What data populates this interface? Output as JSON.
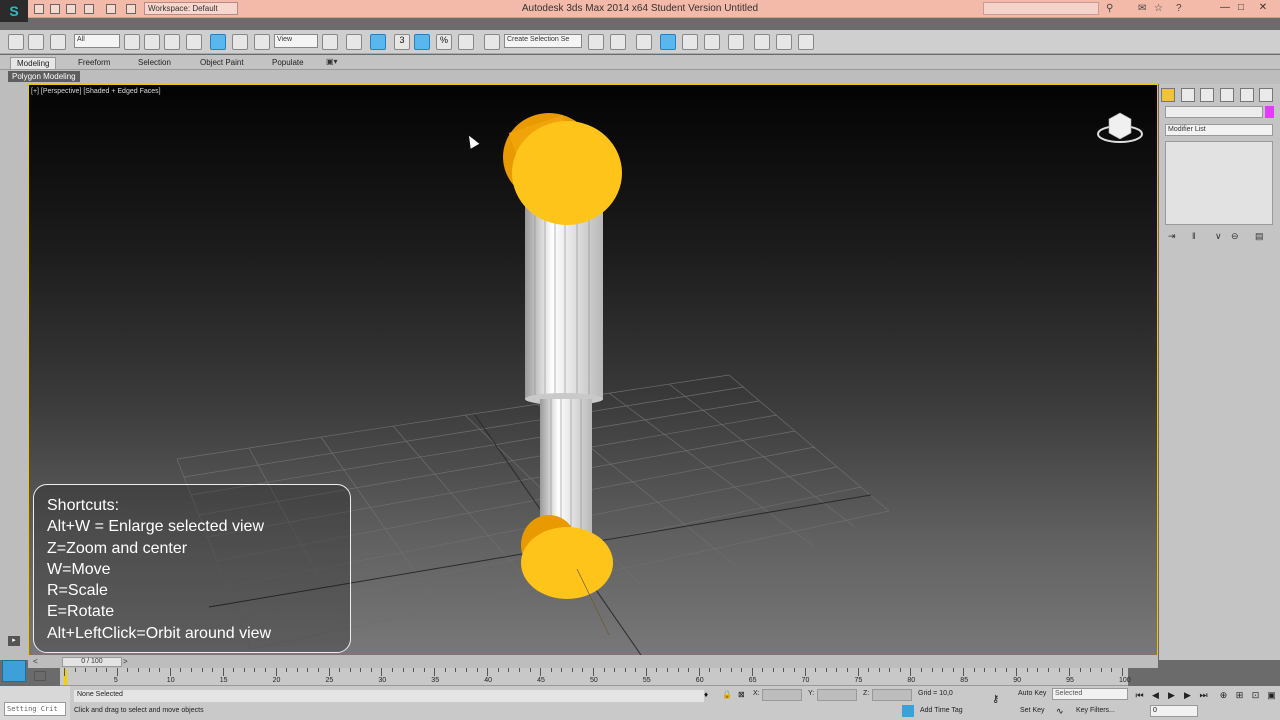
{
  "titlebar": {
    "title": "Autodesk 3ds Max  2014 x64    Student Version    Untitled",
    "workspace": "Workspace: Default",
    "min_glyph": "—",
    "restore_glyph": "□",
    "close_glyph": "✕"
  },
  "toolbar": {
    "filter": "All",
    "refcoord": "View",
    "selset": "Create Selection Se",
    "snap_label": "3",
    "percent_label": "%"
  },
  "ribbon": {
    "tabs": [
      "Modeling",
      "Freeform",
      "Selection",
      "Object Paint",
      "Populate"
    ],
    "active_tab": "Modeling",
    "subtab": "Polygon Modeling"
  },
  "viewport": {
    "label": "[+] [Perspective] [Shaded + Edged Faces]",
    "shortcuts": [
      "Shortcuts:",
      "Alt+W = Enlarge selected view",
      "Z=Zoom and center",
      "W=Move",
      "R=Scale",
      "E=Rotate",
      "Alt+LeftClick=Orbit around view"
    ]
  },
  "command_panel": {
    "modifier_list": "Modifier List"
  },
  "timeline": {
    "slider": "0 / 100",
    "ticks": [
      "5",
      "10",
      "15",
      "20",
      "25",
      "30",
      "35",
      "40",
      "45",
      "50",
      "55",
      "60",
      "65",
      "70",
      "75",
      "80",
      "85",
      "90",
      "95",
      "100"
    ]
  },
  "status": {
    "selection": "None Selected",
    "prompt": "Click and drag to select and move objects",
    "x_label": "X:",
    "y_label": "Y:",
    "z_label": "Z:",
    "grid": "Grid = 10,0",
    "add_time_tag": "Add Time Tag",
    "auto_key": "Auto Key",
    "set_key": "Set Key",
    "selected": "Selected",
    "key_filters": "Key Filters...",
    "frame": "0",
    "listener": "Setting Crit"
  },
  "colors": {
    "accent_orange": "#f6ad16",
    "selection_yellow": "#f2c500",
    "active_tool": "#58b7ee"
  }
}
